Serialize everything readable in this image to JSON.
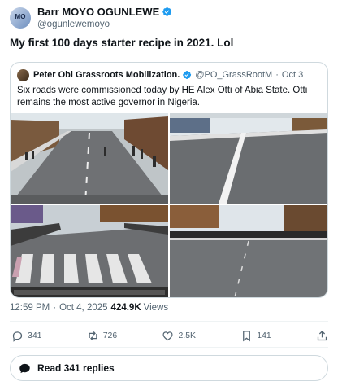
{
  "author": {
    "display_name": "Barr MOYO OGUNLEWE",
    "handle": "@ogunlewemoyo",
    "avatar_text": "MO"
  },
  "tweet": {
    "text": "My first 100 days starter recipe in 2021. Lol"
  },
  "quoted_tweet": {
    "display_name": "Peter Obi Grassroots Mobilization.",
    "handle": "@PO_GrassRootM",
    "separator": "·",
    "date": "Oct 3",
    "text": "Six roads were commissioned today by HE Alex Otti of Abia State. Otti remains the most active governor in Nigeria.",
    "photos": [
      "road-photo-1",
      "road-photo-2",
      "road-photo-3",
      "road-photo-4"
    ]
  },
  "meta": {
    "time": "12:59 PM",
    "separator": "·",
    "date": "Oct 4, 2025",
    "views_count": "424.9K",
    "views_label": "Views"
  },
  "actions": {
    "replies": "341",
    "reposts": "726",
    "likes": "2.5K",
    "bookmarks": "141"
  },
  "read_replies": {
    "label": "Read 341 replies"
  },
  "icons": [
    "verified-icon",
    "more-icon",
    "reply-icon",
    "repost-icon",
    "like-icon",
    "bookmark-icon",
    "share-icon",
    "chat-bubble-icon"
  ],
  "colors": {
    "verified": "#1d9bf0",
    "muted": "#536471",
    "border": "#cfd9de",
    "text": "#0f1419"
  }
}
